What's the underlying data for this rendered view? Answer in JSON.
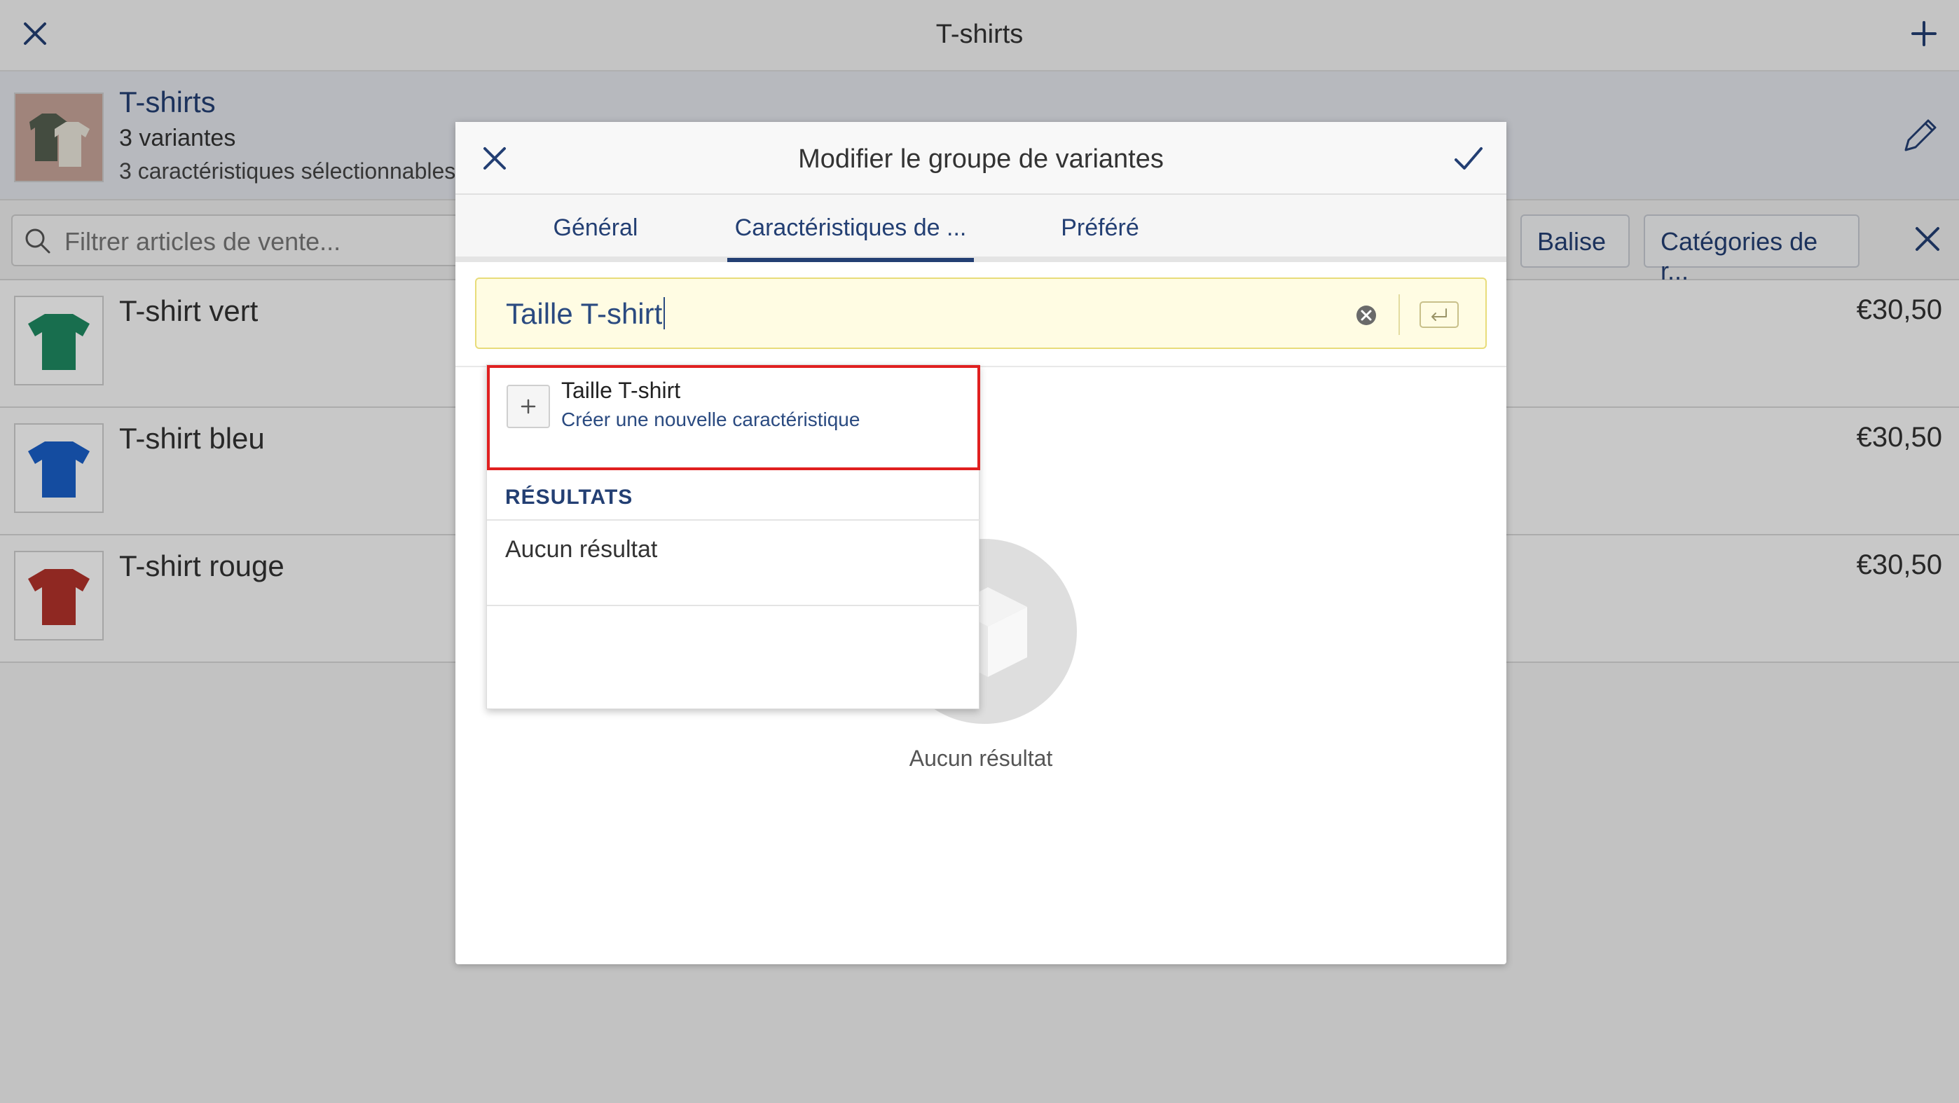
{
  "topbar": {
    "title": "T-shirts",
    "close_icon": "close-icon",
    "add_icon": "plus-icon"
  },
  "group": {
    "name": "T-shirts",
    "variants": "3 variantes",
    "selectable": "3 caractéristiques sélectionnables",
    "edit_icon": "pencil-icon"
  },
  "filter": {
    "placeholder": "Filtrer articles de vente...",
    "chip_tag": "Balise",
    "chip_category": "Catégories de r..."
  },
  "items": [
    {
      "name": "T-shirt vert",
      "price": "€30,50",
      "color": "#1f8a62"
    },
    {
      "name": "T-shirt bleu",
      "price": "€30,50",
      "color": "#1a5fc8"
    },
    {
      "name": "T-shirt rouge",
      "price": "€30,50",
      "color": "#b3322b"
    }
  ],
  "modal": {
    "title": "Modifier le groupe de variantes",
    "tabs": [
      "Général",
      "Caractéristiques de ...",
      "Préféré"
    ],
    "active_tab": 1,
    "search_value": "Taille T-shirt",
    "empty_text": "Aucun résultat"
  },
  "dropdown": {
    "create_name": "Taille T-shirt",
    "create_sub": "Créer une nouvelle caractéristique",
    "results_header": "RÉSULTATS",
    "no_result": "Aucun résultat"
  },
  "colors": {
    "accent": "#233f73",
    "highlight": "#e02020",
    "search_bg": "#fffce3"
  }
}
